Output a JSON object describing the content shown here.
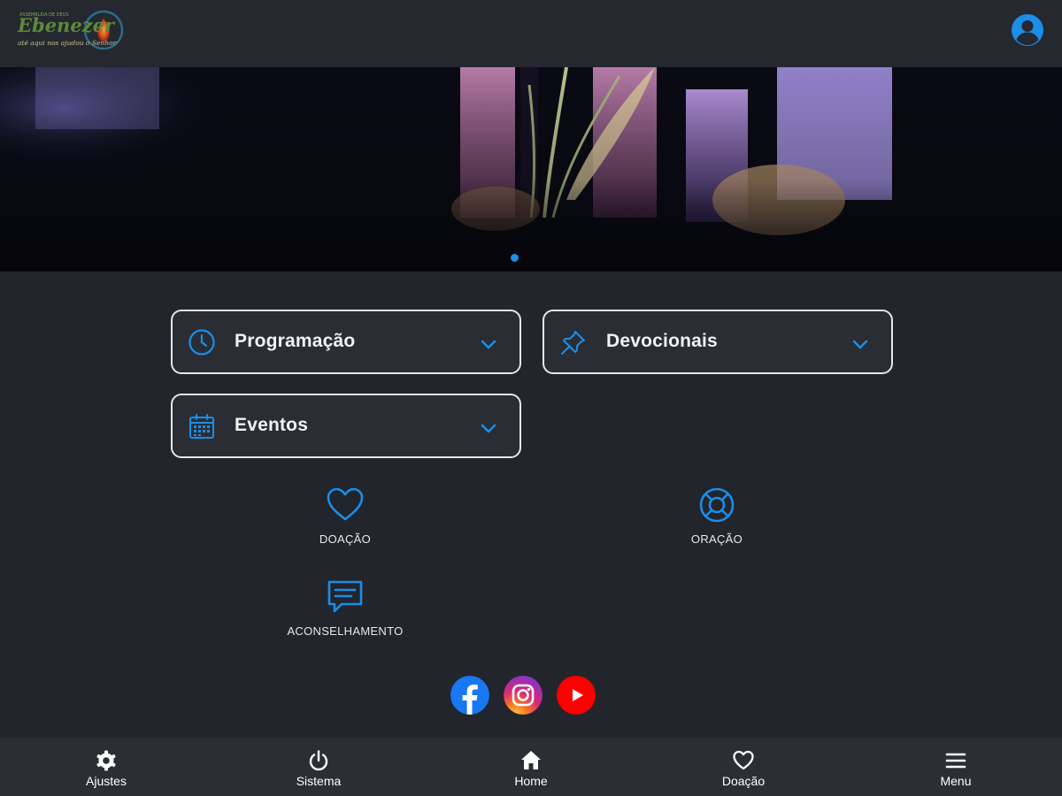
{
  "header": {
    "logo_icon": "church-logo",
    "profile_icon": "user-circle-icon"
  },
  "banner": {
    "carousel_active_index": 0,
    "carousel_count": 1
  },
  "accordions": [
    {
      "label": "Programação",
      "icon": "clock-icon"
    },
    {
      "label": "Devocionais",
      "icon": "pin-icon"
    },
    {
      "label": "Eventos",
      "icon": "calendar-icon"
    }
  ],
  "shortcuts": {
    "doacao": "DOAÇÃO",
    "oracao": "ORAÇÃO",
    "aconselhamento": "ACONSELHAMENTO"
  },
  "social": [
    "facebook-icon",
    "instagram-icon",
    "youtube-icon"
  ],
  "bottom_nav": {
    "ajustes": "Ajustes",
    "sistema": "Sistema",
    "home": "Home",
    "doacao": "Doação",
    "menu": "Menu"
  },
  "colors": {
    "accent": "#1a8ee8",
    "background": "#23252c",
    "card": "#2b2d35",
    "nav": "#2c2e36",
    "facebook": "#1877f2",
    "youtube": "#ff0000"
  }
}
